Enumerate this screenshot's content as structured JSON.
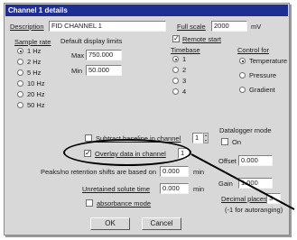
{
  "dialog": {
    "title": "Channel 1 details",
    "description_label": "Description",
    "description_value": "FID CHANNEL 1",
    "units_label": "Full scale",
    "units_value": "2000",
    "units_suffix": "mV",
    "sample_rate": {
      "heading": "Sample rate",
      "options": [
        "1 Hz",
        "2 Hz",
        "5 Hz",
        "10 Hz",
        "20 Hz",
        "50 Hz"
      ],
      "selected_index": 0
    },
    "default_display_limits": {
      "heading": "Default display limits",
      "max_label": "Max",
      "max_value": "750.000",
      "min_label": "Min",
      "min_value": "50.000"
    },
    "remote_start": {
      "label": "Remote start",
      "checked": true,
      "timebase_heading": "Timebase",
      "options": [
        "1",
        "2",
        "3",
        "4"
      ],
      "selected_index": 0
    },
    "control_for": {
      "heading": "Control for",
      "options": [
        "Temperature",
        "Pressure",
        "Gradient"
      ],
      "selected_index": 0
    },
    "subtract_baseline": {
      "label": "Subtract baseline in channel",
      "checked": false,
      "value": "1"
    },
    "overlay": {
      "label": "Overlay data in channel",
      "checked": true,
      "value": "1"
    },
    "datalogger_mode": {
      "heading": "Datalogger mode",
      "on_label": "On",
      "checked": false,
      "offset_label": "Offset",
      "offset_value": "0.000",
      "gain_label": "Gain",
      "gain_value": "1.000"
    },
    "peaks_label": "Peaks/no retention shifts are based on",
    "peaks_value": "0.000",
    "peaks_unit": "min",
    "unretained_label": "Unretained solute time",
    "unretained_value": "0.000",
    "unretained_unit": "min",
    "absorbance": {
      "label": "absorbance mode",
      "checked": false
    },
    "decimal_places": {
      "label": "Decimal places",
      "value": "3",
      "note": "(-1 for autoranging)"
    },
    "ok_label": "OK",
    "cancel_label": "Cancel"
  },
  "colors": {
    "titlebar": "#1e2e93",
    "dialog_bg": "#d8d8d8",
    "annotation": "#000000"
  }
}
